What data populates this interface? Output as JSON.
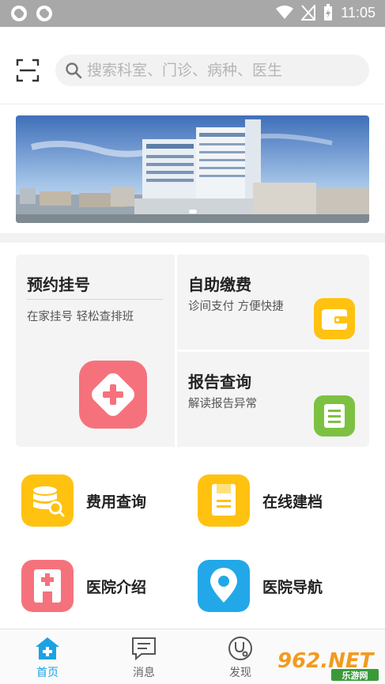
{
  "status_bar": {
    "time": "11:05"
  },
  "search": {
    "placeholder": "搜索科室、门诊、病种、医生"
  },
  "services": {
    "appointment": {
      "title": "预约挂号",
      "subtitle": "在家挂号 轻松查排班"
    },
    "payment": {
      "title": "自助缴费",
      "subtitle": "诊间支付 方便快捷"
    },
    "report": {
      "title": "报告查询",
      "subtitle": "解读报告异常"
    }
  },
  "quick_links": [
    {
      "label": "费用查询",
      "icon": "database-search-icon",
      "color": "#ffc210"
    },
    {
      "label": "在线建档",
      "icon": "document-icon",
      "color": "#ffc210"
    },
    {
      "label": "医院介绍",
      "icon": "hospital-icon",
      "color": "#f5727d"
    },
    {
      "label": "医院导航",
      "icon": "map-pin-icon",
      "color": "#22a8e8"
    }
  ],
  "tabs": [
    {
      "label": "首页",
      "active": true
    },
    {
      "label": "消息",
      "active": false
    },
    {
      "label": "发现",
      "active": false
    }
  ],
  "watermark": {
    "brand": "962.NET",
    "sub": "乐游网"
  },
  "colors": {
    "accent": "#1ba2e4",
    "payment": "#ffc210",
    "report": "#7dc142",
    "appointment": "#f5727d"
  }
}
